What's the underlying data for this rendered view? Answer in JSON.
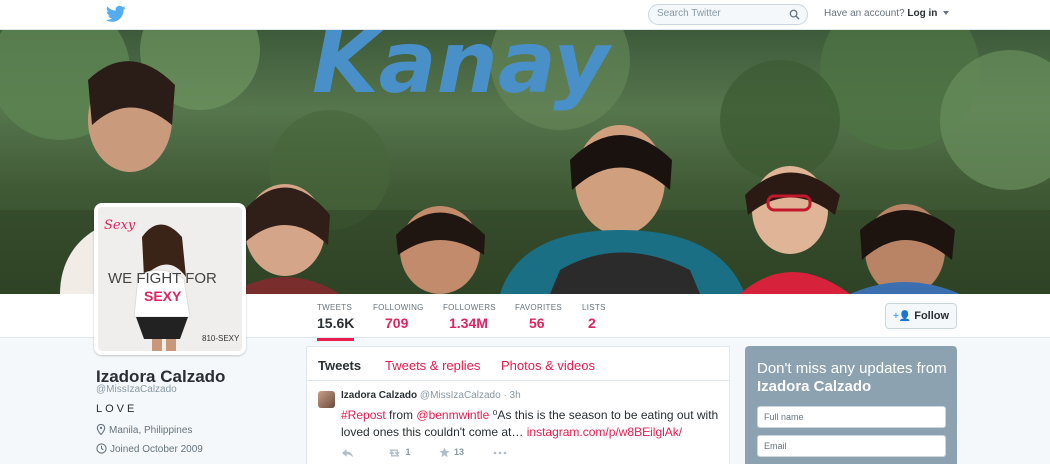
{
  "topbar": {
    "logo_icon": "twitter-bird-icon",
    "search_placeholder": "Search Twitter",
    "account_prompt": "Have an account?",
    "login_label": "Log in"
  },
  "banner": {
    "logo_text": "Kanay"
  },
  "avatar": {
    "brand_script": "Sexy",
    "headline_1": "WE FIGHT FOR",
    "headline_2": "SEXY",
    "corner": "810-SEXY"
  },
  "profile": {
    "name": "Izadora Calzado",
    "handle": "@MissIzaCalzado",
    "bio": "LOVE",
    "location": "Manila, Philippines",
    "joined": "Joined October 2009"
  },
  "stats": [
    {
      "label": "TWEETS",
      "value": "15.6K"
    },
    {
      "label": "FOLLOWING",
      "value": "709"
    },
    {
      "label": "FOLLOWERS",
      "value": "1.34M"
    },
    {
      "label": "FAVORITES",
      "value": "56"
    },
    {
      "label": "LISTS",
      "value": "2"
    }
  ],
  "follow_button": "Follow",
  "tabs": [
    "Tweets",
    "Tweets & replies",
    "Photos & videos"
  ],
  "tweet": {
    "author": "Izadora Calzado",
    "handle": "@MissIzaCalzado",
    "time": "· 3h",
    "hashtag": "#Repost",
    "text_from": "from",
    "mention": "@benmwintle",
    "text_body": "⁰As this is the season to be eating out with loved ones this couldn't come at…",
    "link": "instagram.com/p/w8BEilglAk/",
    "retweets": "1",
    "favorites": "13"
  },
  "signup": {
    "heading_pre": "Don't miss any updates from",
    "heading_name": "Izadora Calzado",
    "fullname_placeholder": "Full name",
    "email_placeholder": "Email"
  },
  "colors": {
    "accent": "#e81c4f",
    "twitter_blue": "#55acee",
    "signup_bg": "#8da2b1"
  }
}
